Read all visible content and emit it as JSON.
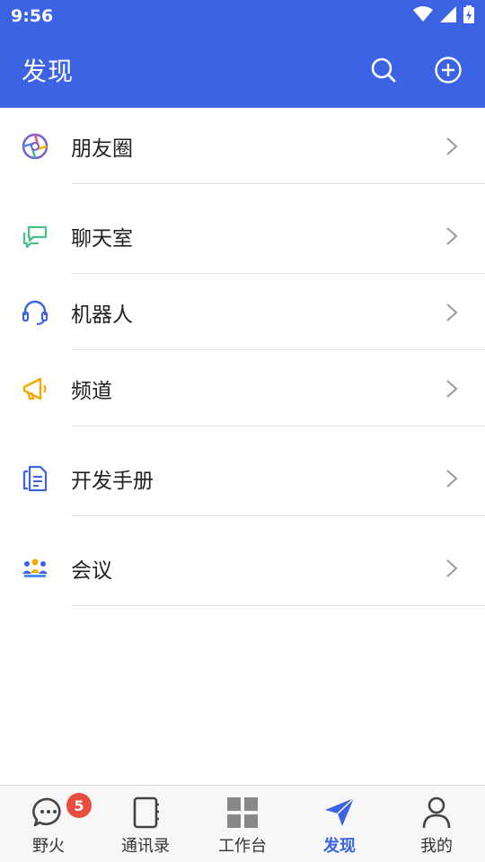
{
  "status_bar": {
    "time": "9:56"
  },
  "header": {
    "title": "发现"
  },
  "menu": [
    {
      "label": "朋友圈",
      "icon": "moments-icon"
    },
    {
      "label": "聊天室",
      "icon": "chatroom-icon"
    },
    {
      "label": "机器人",
      "icon": "headset-icon"
    },
    {
      "label": "频道",
      "icon": "megaphone-icon"
    },
    {
      "label": "开发手册",
      "icon": "document-icon"
    },
    {
      "label": "会议",
      "icon": "meeting-icon"
    }
  ],
  "bottom_nav": [
    {
      "label": "野火",
      "icon": "chat-bubble-icon",
      "badge": "5"
    },
    {
      "label": "通讯录",
      "icon": "contacts-icon"
    },
    {
      "label": "工作台",
      "icon": "grid-icon"
    },
    {
      "label": "发现",
      "icon": "navigation-icon",
      "active": true
    },
    {
      "label": "我的",
      "icon": "person-icon"
    }
  ],
  "colors": {
    "primary": "#3b63e3",
    "badge": "#e74c3c"
  }
}
